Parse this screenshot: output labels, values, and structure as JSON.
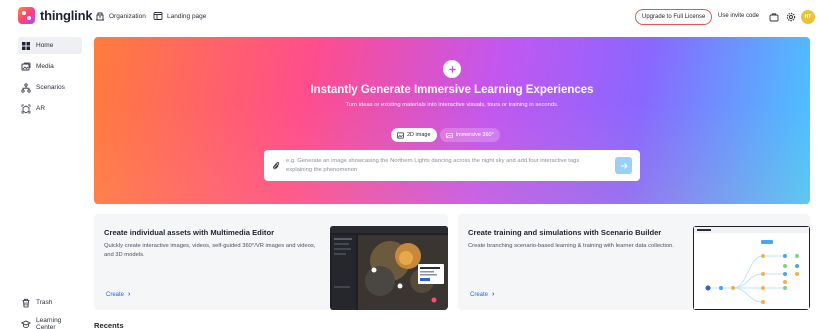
{
  "brand": {
    "name": "thinglink"
  },
  "header": {
    "nav": [
      {
        "label": "Organization",
        "icon": "building-icon"
      },
      {
        "label": "Landing page",
        "icon": "browser-window-icon"
      }
    ],
    "upgrade_label": "Upgrade to Full License",
    "invite_label": "Use invite code",
    "icons": [
      "briefcase-icon",
      "gear-icon"
    ],
    "avatar_initials": "HT",
    "accent_color": "#e0565a"
  },
  "sidebar": {
    "items": [
      {
        "label": "Home",
        "icon": "grid-icon",
        "active": true
      },
      {
        "label": "Media",
        "icon": "image-stack-icon",
        "active": false
      },
      {
        "label": "Scenarios",
        "icon": "flow-icon",
        "active": false
      },
      {
        "label": "AR",
        "icon": "ar-cube-icon",
        "active": false
      }
    ],
    "bottom": [
      {
        "label": "Trash",
        "icon": "trash-icon"
      },
      {
        "label": "Learning Center",
        "icon": "graduation-cap-icon"
      }
    ]
  },
  "hero": {
    "title": "Instantly Generate Immersive Learning Experiences",
    "subtitle": "Turn ideas or existing materials into interactive visuals, tours or training in seconds.",
    "modes": [
      {
        "label": "2D image",
        "selected": true,
        "icon": "image-icon"
      },
      {
        "label": "Immersive 360°",
        "selected": false,
        "icon": "panorama-icon"
      }
    ],
    "prompt_placeholder": "e.g. Generate an image showcasing the Northern Lights dancing across the night sky and add four interactive tags explaining the phenomenon"
  },
  "cards": [
    {
      "title": "Create individual assets with Multimedia Editor",
      "description": "Quickly create interactive images, videos, self-guided 360°/VR images and videos, and 3D models.",
      "link": "Create"
    },
    {
      "title": "Create training and simulations with Scenario Builder",
      "description": "Create branching scenario-based learning & training with learner data collection.",
      "link": "Create"
    }
  ],
  "recents_heading": "Recents"
}
